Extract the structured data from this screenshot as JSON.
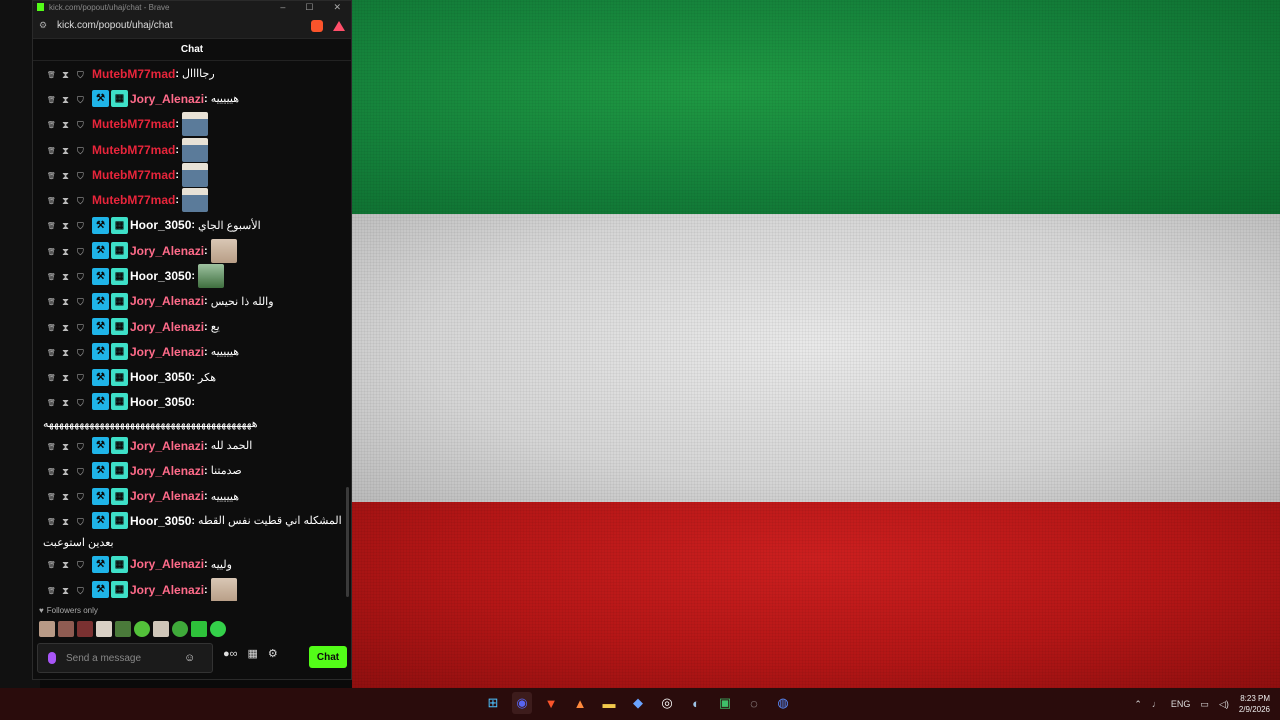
{
  "window": {
    "title": "kick.com/popout/uhaj/chat - Brave",
    "url": "kick.com/popout/uhaj/chat",
    "chat_header": "Chat"
  },
  "messages": [
    {
      "user": "MutebM77mad",
      "color": "red",
      "badges": false,
      "text": "رجاااال",
      "emote": ""
    },
    {
      "user": "Jory_Alenazi",
      "color": "pink",
      "badges": true,
      "text": "هيييييه",
      "emote": ""
    },
    {
      "user": "MutebM77mad",
      "color": "red",
      "badges": false,
      "text": "",
      "emote": "person"
    },
    {
      "user": "MutebM77mad",
      "color": "red",
      "badges": false,
      "text": "",
      "emote": "person"
    },
    {
      "user": "MutebM77mad",
      "color": "red",
      "badges": false,
      "text": "",
      "emote": "person"
    },
    {
      "user": "MutebM77mad",
      "color": "red",
      "badges": false,
      "text": "",
      "emote": "person"
    },
    {
      "user": "Hoor_3050",
      "color": "white",
      "badges": true,
      "text": "الأسبوع الجاي",
      "emote": ""
    },
    {
      "user": "Jory_Alenazi",
      "color": "pink",
      "badges": true,
      "text": "",
      "emote": "kid"
    },
    {
      "user": "Hoor_3050",
      "color": "white",
      "badges": true,
      "text": "",
      "emote": "green"
    },
    {
      "user": "Jory_Alenazi",
      "color": "pink",
      "badges": true,
      "text": "والله ذا نحيس",
      "emote": ""
    },
    {
      "user": "Jory_Alenazi",
      "color": "pink",
      "badges": true,
      "text": "يع",
      "emote": ""
    },
    {
      "user": "Jory_Alenazi",
      "color": "pink",
      "badges": true,
      "text": "هيييييه",
      "emote": ""
    },
    {
      "user": "Hoor_3050",
      "color": "white",
      "badges": true,
      "text": "هكر",
      "emote": ""
    },
    {
      "user": "Hoor_3050",
      "color": "white",
      "badges": true,
      "text": "",
      "emote": "",
      "overflow": "هههههههههههههههههههههههههههههههههههههههههه"
    },
    {
      "user": "Jory_Alenazi",
      "color": "pink",
      "badges": true,
      "text": "الحمد لله",
      "emote": ""
    },
    {
      "user": "Jory_Alenazi",
      "color": "pink",
      "badges": true,
      "text": "صدمتنا",
      "emote": ""
    },
    {
      "user": "Jory_Alenazi",
      "color": "pink",
      "badges": true,
      "text": "هيييييه",
      "emote": ""
    },
    {
      "user": "Hoor_3050",
      "color": "white",
      "badges": true,
      "text": "المشكله اني قطيت نفس القطه",
      "emote": "",
      "overflow": "بعدين استوعبت"
    },
    {
      "user": "Jory_Alenazi",
      "color": "pink",
      "badges": true,
      "text": "ولييه",
      "emote": ""
    },
    {
      "user": "Jory_Alenazi",
      "color": "pink",
      "badges": true,
      "text": "",
      "emote": "kid"
    }
  ],
  "followers_only": "Followers only",
  "composer": {
    "placeholder": "Send a message",
    "send_label": "Chat"
  },
  "taskbar": {
    "language": "ENG",
    "time": "8:23 PM",
    "date": "2/9/2026"
  },
  "colors": {
    "kick_green": "#53fc18",
    "user_red": "#e8253b",
    "user_pink": "#ff6b8a"
  }
}
